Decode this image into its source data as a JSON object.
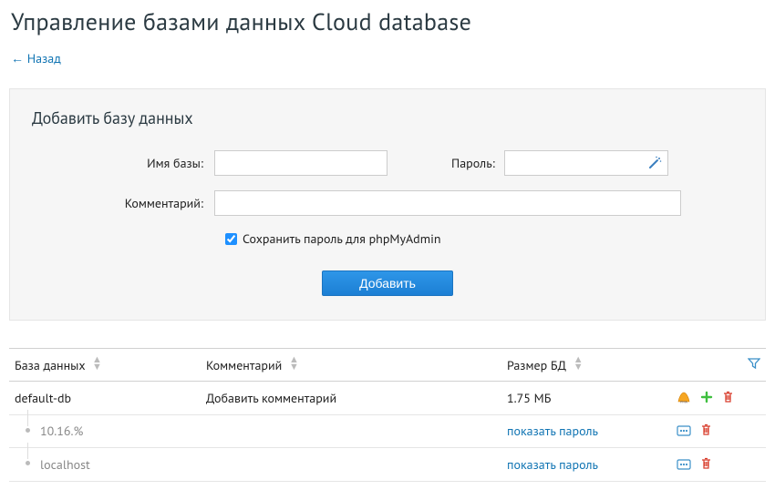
{
  "page_title": "Управление базами данных Cloud database",
  "back_link": "← Назад",
  "add_panel": {
    "heading": "Добавить базу данных",
    "name_label": "Имя базы:",
    "password_label": "Пароль:",
    "comment_label": "Комментарий:",
    "save_pw_label": "Сохранить пароль для phpMyAdmin",
    "submit_label": "Добавить",
    "name_value": "",
    "password_value": "",
    "comment_value": ""
  },
  "table": {
    "headers": {
      "db": "База данных",
      "comment": "Комментарий",
      "size": "Размер БД"
    },
    "rows": [
      {
        "name": "default-db",
        "comment": "Добавить комментарий",
        "size": "1.75 МБ",
        "type": "db"
      },
      {
        "name": "10.16.%",
        "show_pw": "показать пароль",
        "type": "host"
      },
      {
        "name": "localhost",
        "show_pw": "показать пароль",
        "type": "host"
      }
    ]
  }
}
